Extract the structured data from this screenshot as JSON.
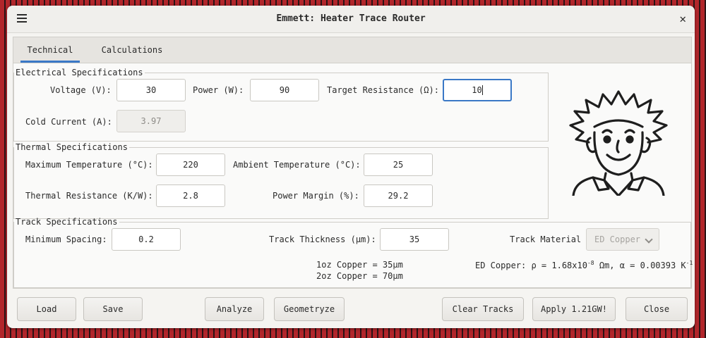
{
  "window": {
    "title": "Emmett: Heater Trace Router"
  },
  "icons": {
    "menu": "hamburger-menu-icon",
    "close": "close-icon",
    "avatar": "scientist-avatar-icon",
    "dropdown": "chevron-down-icon"
  },
  "tabs": [
    {
      "label": "Technical",
      "active": true
    },
    {
      "label": "Calculations",
      "active": false
    }
  ],
  "electrical": {
    "title": "Electrical Specifications",
    "voltage": {
      "label": "Voltage (V):",
      "value": "30"
    },
    "power": {
      "label": "Power (W):",
      "value": "90"
    },
    "target_resistance": {
      "label": "Target Resistance (Ω):",
      "value": "10"
    },
    "cold_current": {
      "label": "Cold Current (A):",
      "value": "3.97"
    }
  },
  "thermal": {
    "title": "Thermal Specifications",
    "max_temp": {
      "label": "Maximum Temperature (°C):",
      "value": "220"
    },
    "ambient_temp": {
      "label": "Ambient Temperature (°C):",
      "value": "25"
    },
    "thermal_resistance": {
      "label": "Thermal Resistance (K/W):",
      "value": "2.8"
    },
    "power_margin": {
      "label": "Power Margin (%):",
      "value": "29.2"
    }
  },
  "track": {
    "title": "Track Specifications",
    "min_spacing": {
      "label": "Minimum Spacing:",
      "value": "0.2"
    },
    "thickness": {
      "label": "Track Thickness (μm):",
      "value": "35"
    },
    "material": {
      "label": "Track Material",
      "value": "ED Copper"
    },
    "note_1oz": "1oz Copper = 35μm",
    "note_2oz": "2oz Copper = 70μm",
    "material_props": {
      "prefix": "ED Copper: ρ = 1.68x10",
      "exp1": "-8",
      "middle": " Ωm, α = 0.00393 K",
      "exp2": "-1"
    }
  },
  "buttons": {
    "load": "Load",
    "save": "Save",
    "analyze": "Analyze",
    "geometryze": "Geometryze",
    "clear_tracks": "Clear Tracks",
    "apply": "Apply 1.21GW!",
    "close": "Close"
  },
  "colors": {
    "accent": "#3a78c6",
    "background_red": "#b2262b"
  }
}
